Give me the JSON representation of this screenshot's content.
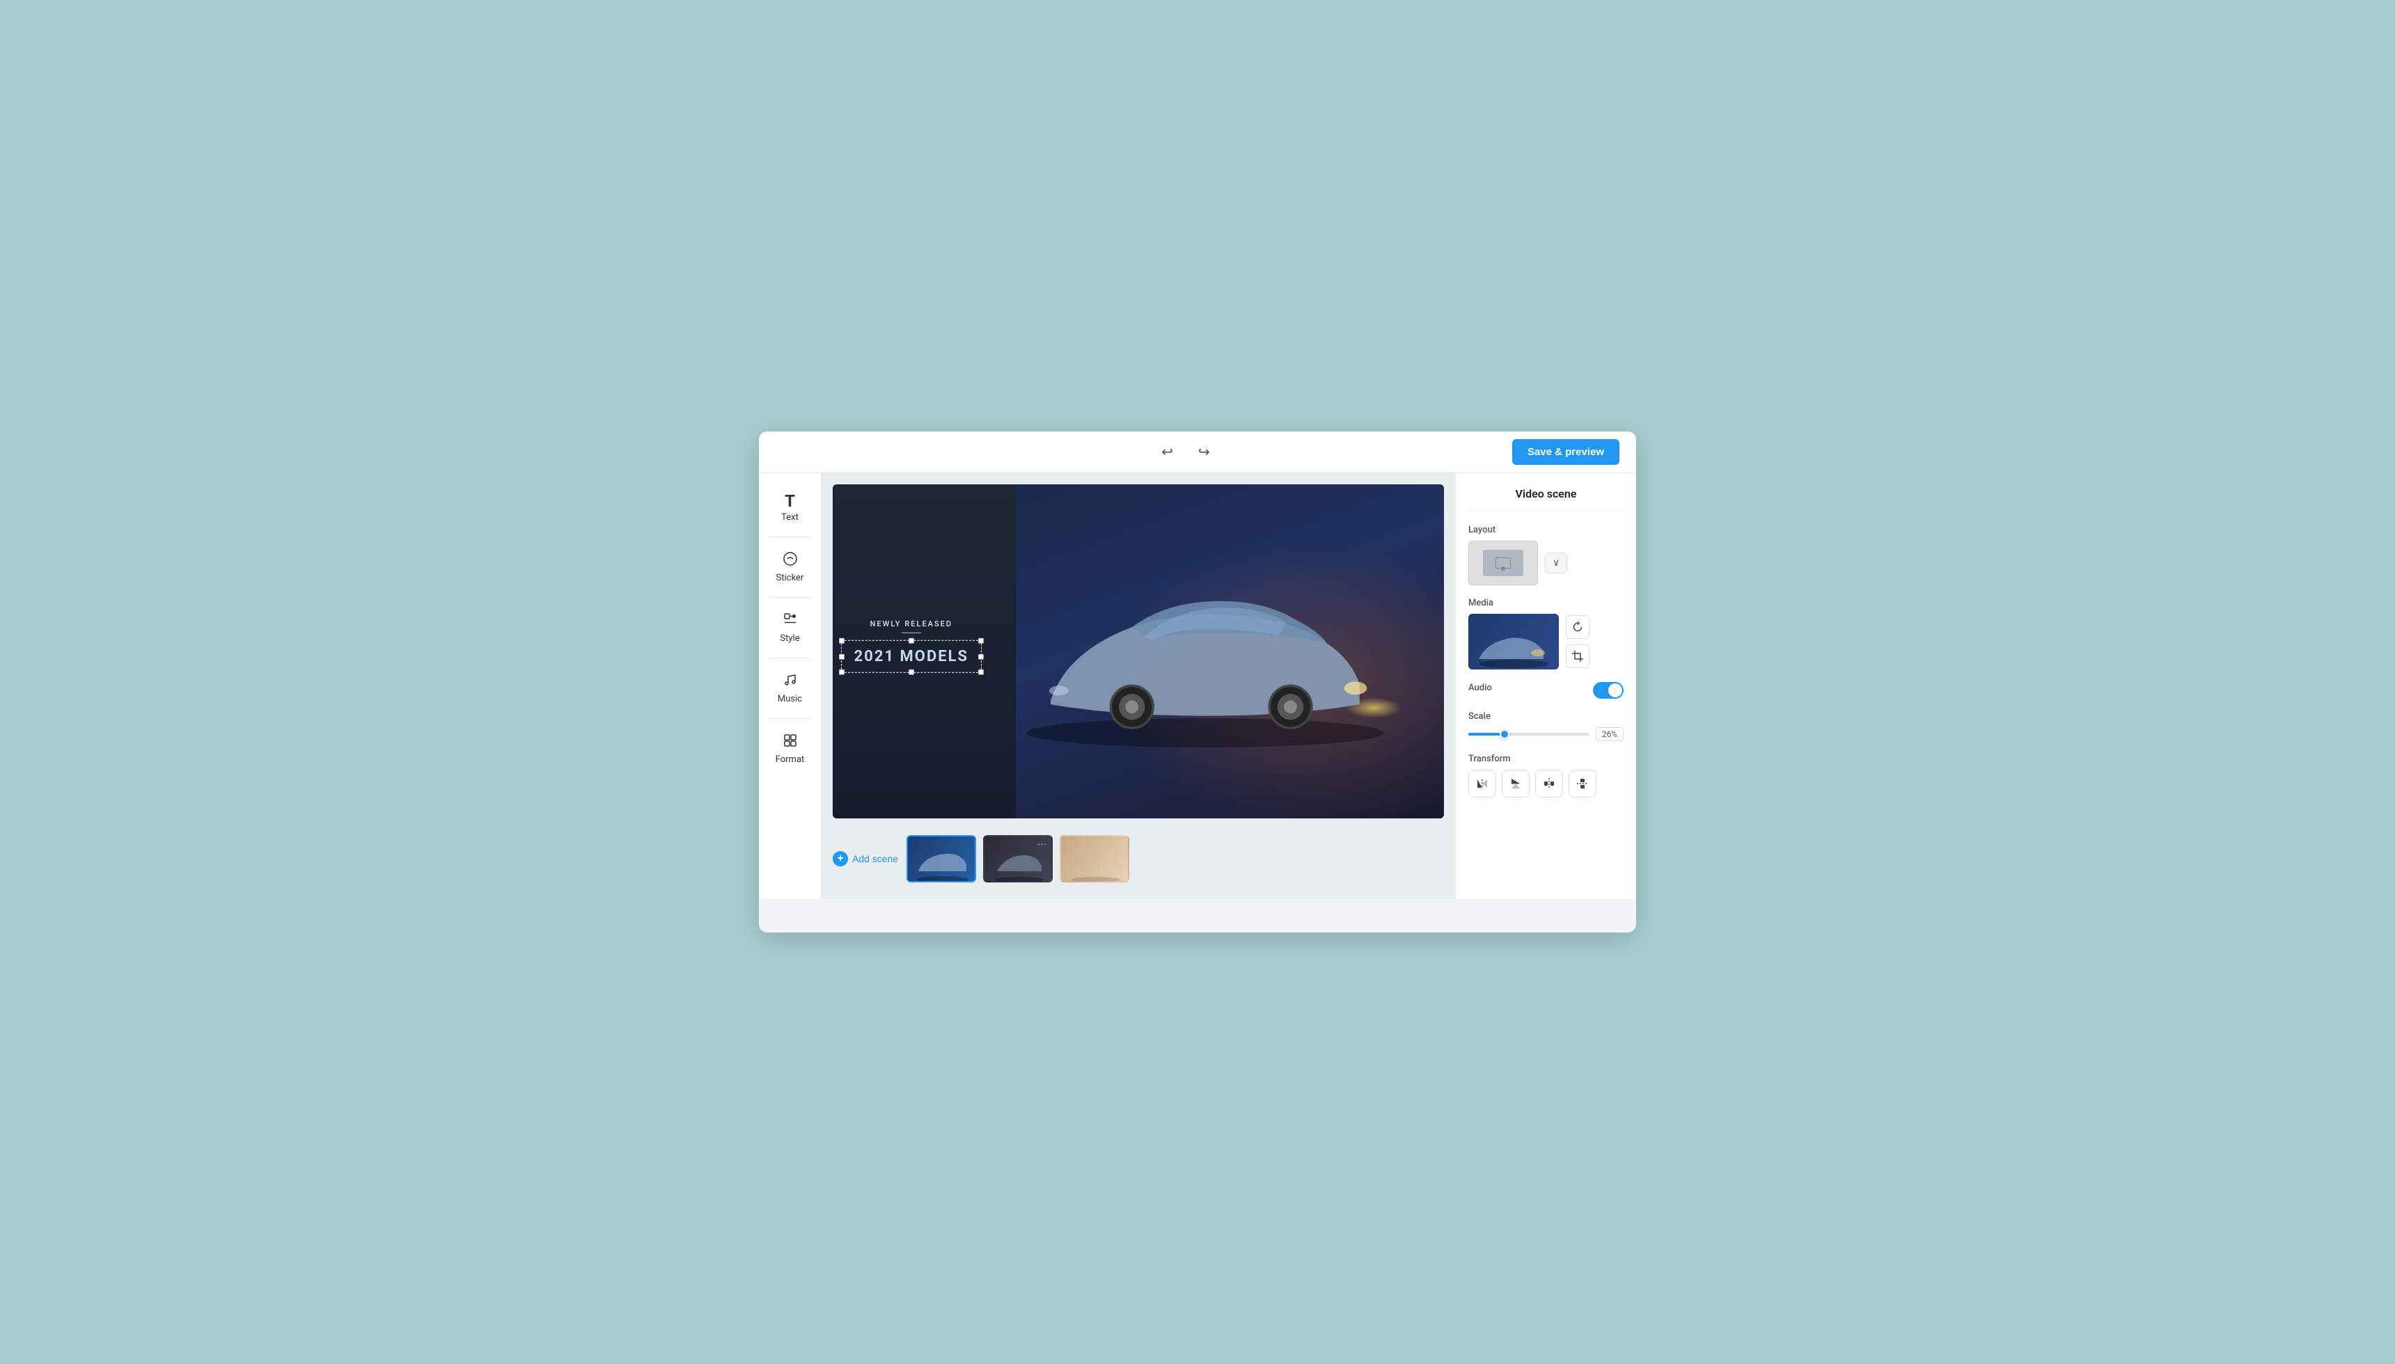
{
  "header": {
    "save_preview_label": "Save & preview"
  },
  "sidebar": {
    "items": [
      {
        "id": "text",
        "label": "Text",
        "icon": "T"
      },
      {
        "id": "sticker",
        "label": "Sticker",
        "icon": "⏱"
      },
      {
        "id": "style",
        "label": "Style",
        "icon": "+"
      },
      {
        "id": "music",
        "label": "Music",
        "icon": "♫"
      },
      {
        "id": "format",
        "label": "Format",
        "icon": "▦"
      }
    ]
  },
  "canvas": {
    "newly_released": "NEWLY RELEASED",
    "models_text": "2021 MODELS"
  },
  "bottom": {
    "add_scene_label": "Add scene",
    "thumbnails": [
      {
        "id": "thumb1",
        "type": "car1"
      },
      {
        "id": "thumb2",
        "type": "car2"
      },
      {
        "id": "thumb3",
        "type": "car3"
      }
    ]
  },
  "right_panel": {
    "title": "Video scene",
    "layout_label": "Layout",
    "media_label": "Media",
    "audio_label": "Audio",
    "audio_enabled": true,
    "scale_label": "Scale",
    "scale_value": "26%",
    "transform_label": "Transform",
    "dropdown_arrow": "∨",
    "transform_buttons": [
      {
        "id": "flip-h",
        "icon": "⟲"
      },
      {
        "id": "flip-v",
        "icon": "⟳"
      },
      {
        "id": "align-center",
        "icon": "⊣⊢"
      },
      {
        "id": "align-middle",
        "icon": "⊤⊥"
      }
    ]
  }
}
